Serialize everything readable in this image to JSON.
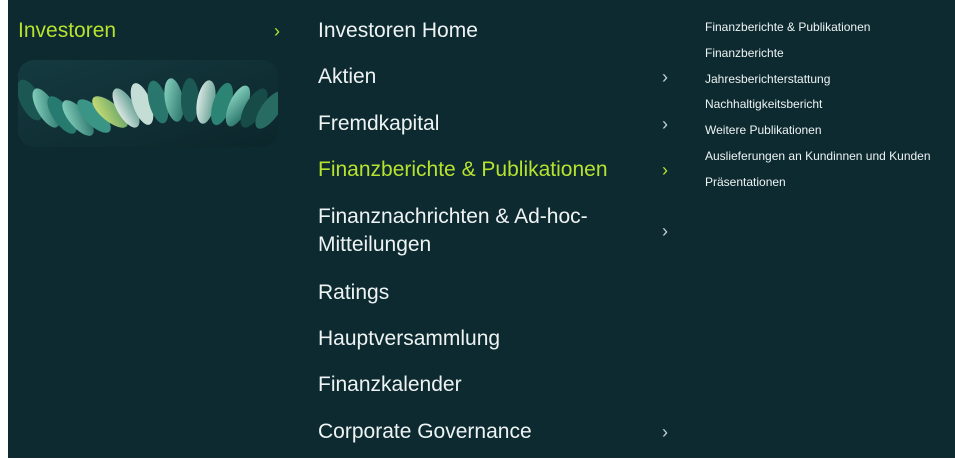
{
  "nav": {
    "section": {
      "label": "Investoren",
      "chevron": "chevron-right-icon"
    },
    "main_items": [
      {
        "label": "Investoren Home",
        "has_submenu": false,
        "active": false
      },
      {
        "label": "Aktien",
        "has_submenu": true,
        "active": false
      },
      {
        "label": "Fremdkapital",
        "has_submenu": true,
        "active": false
      },
      {
        "label": "Finanzberichte & Publikationen",
        "has_submenu": true,
        "active": true
      },
      {
        "label": "Finanznachrichten & Ad-hoc-Mitteilungen",
        "has_submenu": true,
        "active": false
      },
      {
        "label": "Ratings",
        "has_submenu": false,
        "active": false
      },
      {
        "label": "Hauptversammlung",
        "has_submenu": false,
        "active": false
      },
      {
        "label": "Finanzkalender",
        "has_submenu": false,
        "active": false
      },
      {
        "label": "Corporate Governance",
        "has_submenu": true,
        "active": false
      }
    ],
    "sub_items": [
      "Finanzberichte & Publikationen",
      "Finanzberichte",
      "Jahresberichterstattung",
      "Nachhaltigkeitsbericht",
      "Weitere Publikationen",
      "Auslieferungen an Kundinnen und Kunden",
      "Präsentationen"
    ]
  },
  "colors": {
    "background": "#0d2a30",
    "accent": "#b7e32f",
    "text": "#eef3f3"
  }
}
